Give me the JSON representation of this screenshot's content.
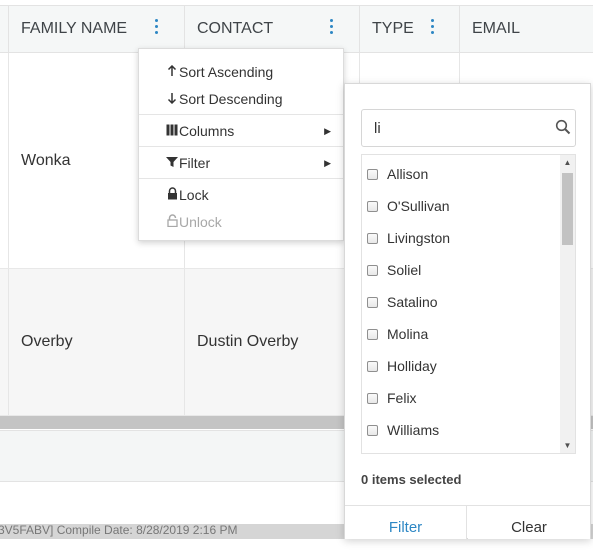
{
  "grid": {
    "columns": [
      {
        "label": "FAMILY NAME",
        "has_menu": true
      },
      {
        "label": "CONTACT",
        "has_menu": true
      },
      {
        "label": "TYPE",
        "has_menu": true
      },
      {
        "label": "EMAIL",
        "has_menu": false
      }
    ],
    "rows": [
      {
        "family_name": "Wonka",
        "contact": ""
      },
      {
        "family_name": "Overby",
        "contact": "Dustin Overby"
      }
    ],
    "compile_text": "3V5FABV] Compile Date: 8/28/2019 2:16 PM"
  },
  "column_menu": {
    "sort_ascending": "Sort Ascending",
    "sort_descending": "Sort Descending",
    "columns": "Columns",
    "filter": "Filter",
    "lock": "Lock",
    "unlock": "Unlock",
    "icons": {
      "sort_ascending": "arrow-up-icon",
      "sort_descending": "arrow-down-icon",
      "columns": "columns-icon",
      "filter": "funnel-icon",
      "lock": "lock-icon",
      "unlock": "unlock-icon"
    }
  },
  "filter_popup": {
    "search_value": "li",
    "options": [
      "Allison",
      "O'Sullivan",
      "Livingston",
      "Soliel",
      "Satalino",
      "Molina",
      "Holliday",
      "Felix",
      "Williams"
    ],
    "selected_count_text": "0 items selected",
    "filter_button": "Filter",
    "clear_button": "Clear"
  },
  "colors": {
    "accent": "#2d87c4",
    "header_bg": "#f5f7f7",
    "row_alt_bg": "#f6f6f6",
    "scrollbar": "#c4c4c4"
  }
}
